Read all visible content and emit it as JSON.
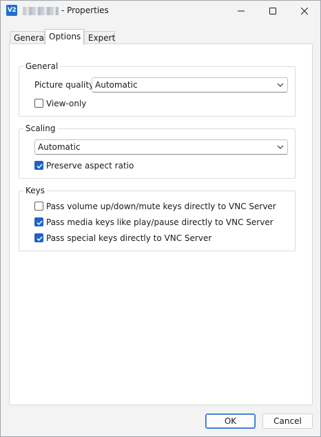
{
  "window": {
    "app_icon_text": "V2",
    "title": "- Properties",
    "icons": [
      "vnc-app-icon",
      "minimize-icon",
      "maximize-icon",
      "close-icon"
    ]
  },
  "tabs": [
    {
      "label": "General",
      "active": false
    },
    {
      "label": "Options",
      "active": true
    },
    {
      "label": "Expert",
      "active": false
    }
  ],
  "general_group": {
    "title": "General",
    "picture_quality_label": "Picture quality:",
    "picture_quality_value": "Automatic",
    "view_only_label": "View-only",
    "view_only_checked": false
  },
  "scaling_group": {
    "title": "Scaling",
    "scaling_value": "Automatic",
    "preserve_aspect_label": "Preserve aspect ratio",
    "preserve_aspect_checked": true
  },
  "keys_group": {
    "title": "Keys",
    "items": [
      {
        "label": "Pass volume up/down/mute keys directly to VNC Server",
        "checked": false
      },
      {
        "label": "Pass media keys like play/pause directly to VNC Server",
        "checked": true
      },
      {
        "label": "Pass special keys directly to VNC Server",
        "checked": true
      }
    ]
  },
  "buttons": {
    "ok_label": "OK",
    "cancel_label": "Cancel"
  },
  "colors": {
    "accent": "#1f63c4",
    "window_bg": "#f3f3f3",
    "page_bg": "#ffffff"
  }
}
